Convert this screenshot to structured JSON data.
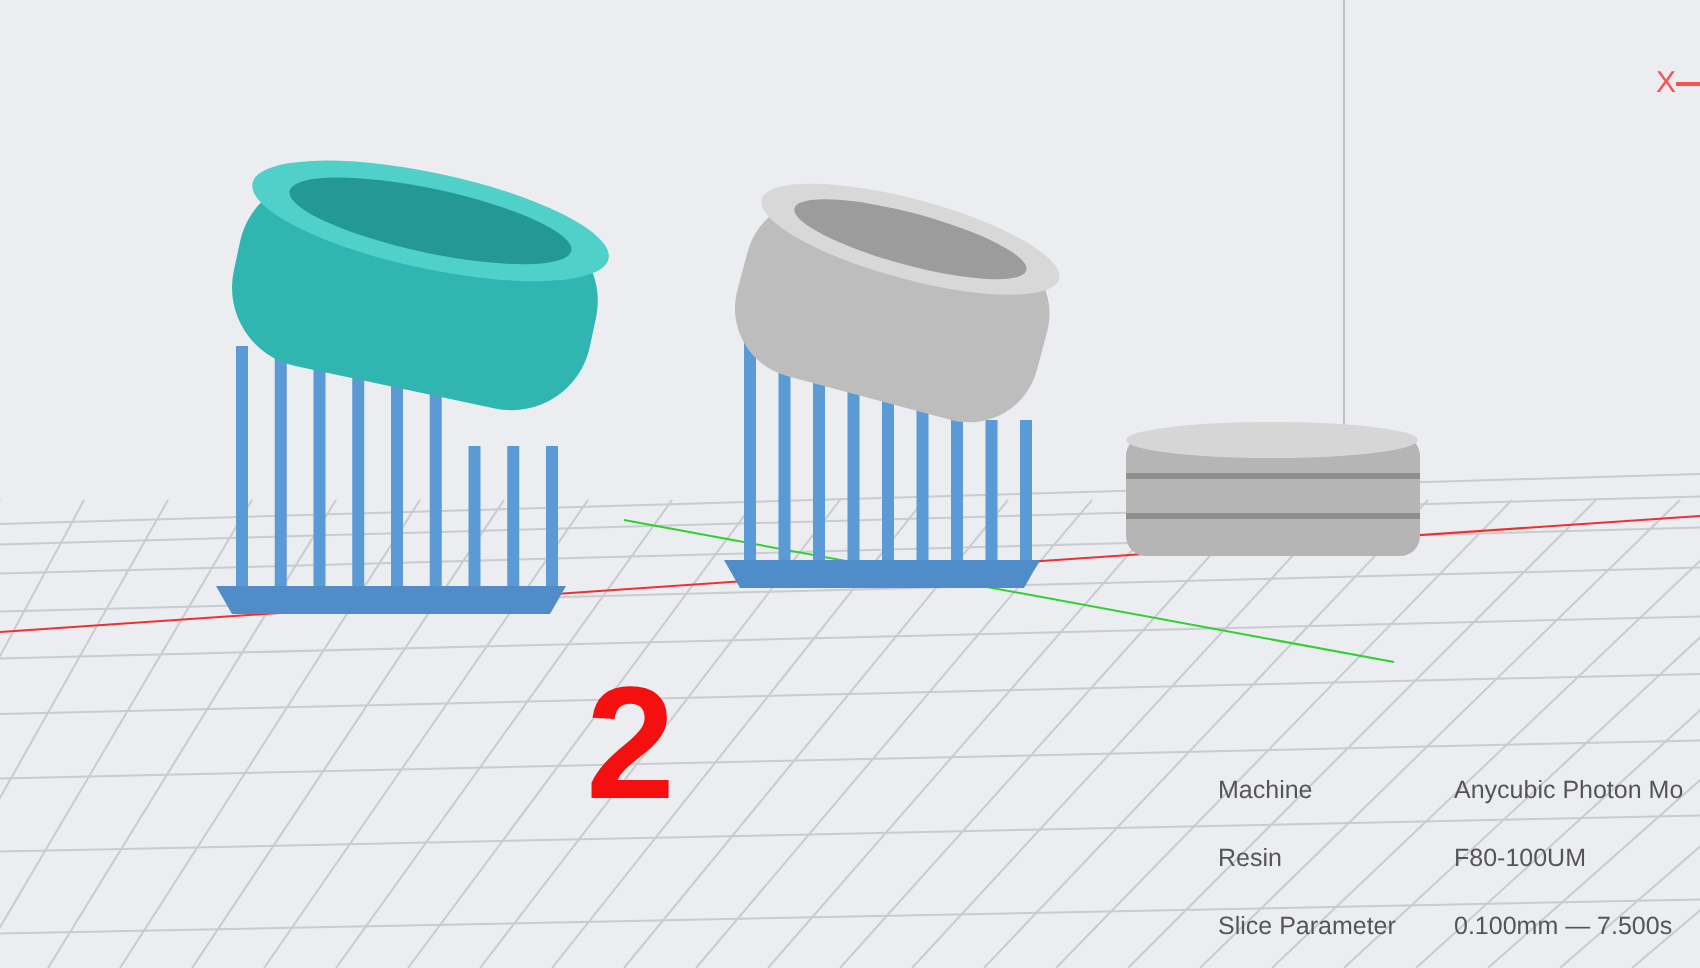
{
  "viewport": {
    "axis_label": "X",
    "plate_number": "2"
  },
  "info": [
    {
      "label": "Machine",
      "value": "Anycubic Photon Mo"
    },
    {
      "label": "Resin",
      "value": "F80-100UM"
    },
    {
      "label": "Slice Parameter",
      "value": "0.100mm — 7.500s"
    }
  ]
}
